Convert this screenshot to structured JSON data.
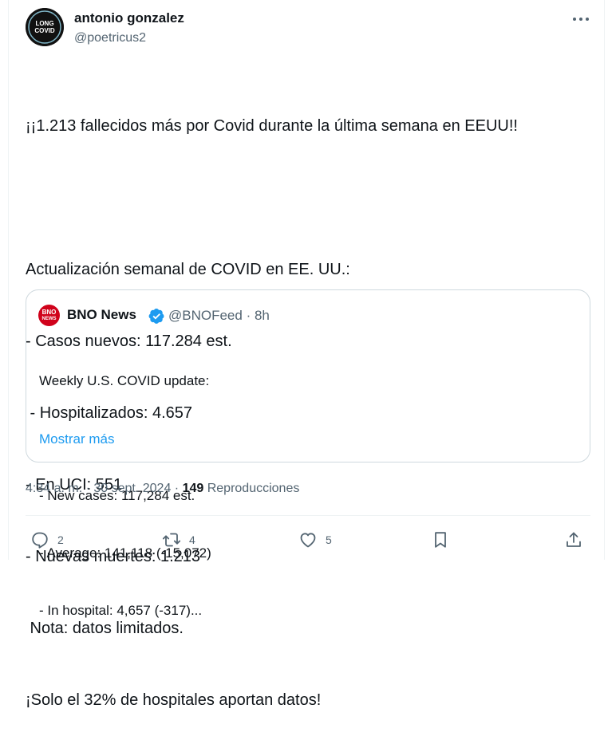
{
  "author": {
    "name": "antonio gonzalez",
    "handle": "@poetricus2",
    "avatar_text": [
      "LONG",
      "COVID"
    ]
  },
  "tweet": {
    "text_lines": [
      "¡¡1.213 fallecidos más por Covid durante la última semana en EEUU!!",
      "",
      "Actualización semanal de COVID en EE. UU.:",
      "- Casos nuevos: 117.284 est.",
      " - Hospitalizados: 4.657",
      "- En UCI: 551",
      "- Nuevas muertes: 1.213",
      " Nota: datos limitados.",
      "¡Solo el 32% de hospitales aportan datos!"
    ]
  },
  "quote": {
    "avatar_text": [
      "BNO",
      "NEWS"
    ],
    "name": "BNO News",
    "handle": "@BNOFeed",
    "time": "8h",
    "text_lines": [
      "Weekly U.S. COVID update:",
      "",
      "- New cases: 117,284 est.",
      "- Average: 141,118 (-15,072)",
      "- In hospital: 4,657 (-317)..."
    ],
    "show_more": "Mostrar más"
  },
  "meta": {
    "time": "4:34 a. m.",
    "date": "30 sept. 2024",
    "views_count": "149",
    "views_label": "Reproducciones"
  },
  "actions": {
    "reply_count": "2",
    "retweet_count": "4",
    "like_count": "5"
  },
  "colors": {
    "text": "#0f1419",
    "secondary": "#536471",
    "link": "#1d9bf0",
    "verified": "#1d9bf0",
    "border": "#cfd9de"
  }
}
